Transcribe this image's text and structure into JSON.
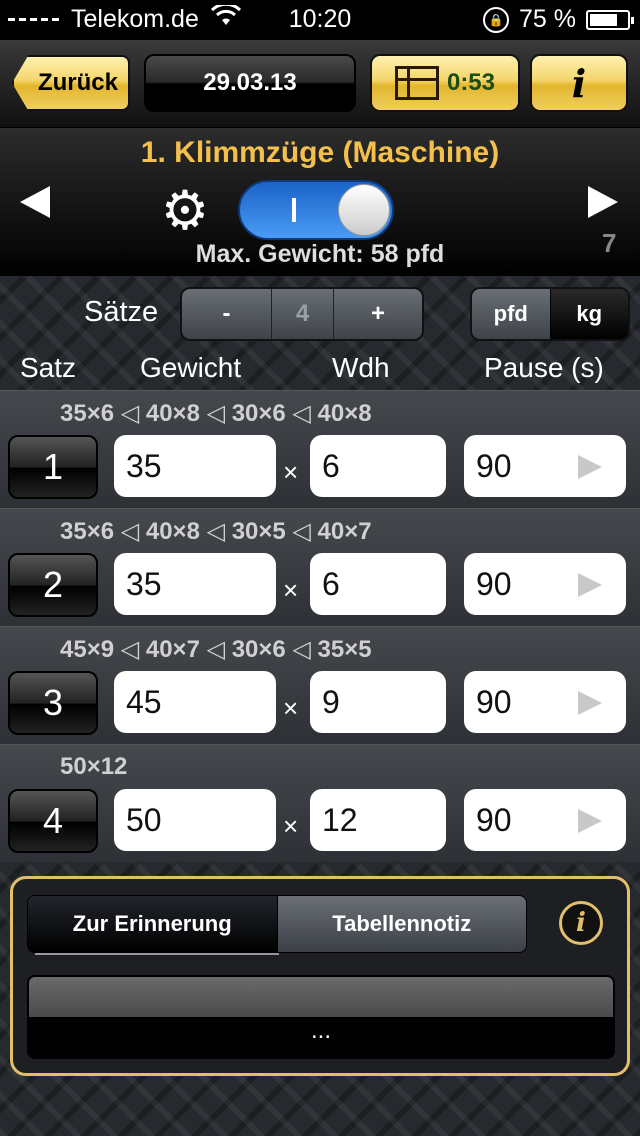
{
  "status": {
    "carrier": "Telekom.de",
    "time": "10:20",
    "battery": "75 %",
    "battery_level": 0.75
  },
  "nav": {
    "back_label": "Zurück",
    "date": "29.03.13",
    "timer": "0:53",
    "info_label": "i"
  },
  "exercise": {
    "title": "1. Klimmzüge (Maschine)",
    "max_weight": "Max. Gewicht: 58 pfd",
    "counter": "7",
    "toggle_on": true
  },
  "sets_control": {
    "label": "Sätze",
    "minus": "-",
    "value": "4",
    "plus": "+"
  },
  "units": {
    "pfd": "pfd",
    "kg": "kg",
    "selected": "kg"
  },
  "columns": {
    "set": "Satz",
    "weight": "Gewicht",
    "reps": "Wdh",
    "pause": "Pause (s)"
  },
  "sets": [
    {
      "num": "1",
      "history": "35×6 ◁ 40×8 ◁ 30×6 ◁ 40×8",
      "weight": "35",
      "reps": "6",
      "pause": "90"
    },
    {
      "num": "2",
      "history": "35×6 ◁ 40×8 ◁ 30×5 ◁ 40×7",
      "weight": "35",
      "reps": "6",
      "pause": "90"
    },
    {
      "num": "3",
      "history": "45×9 ◁ 40×7 ◁ 30×6 ◁ 35×5",
      "weight": "45",
      "reps": "9",
      "pause": "90"
    },
    {
      "num": "4",
      "history": "50×12",
      "weight": "50",
      "reps": "12",
      "pause": "90"
    }
  ],
  "times_symbol": "×",
  "notes": {
    "tab_reminder": "Zur Erinnerung",
    "tab_table_note": "Tabellennotiz",
    "info_label": "i",
    "content": "..."
  },
  "colors": {
    "accent_gold": "#f3c04e",
    "toggle_blue": "#2f80e8",
    "panel_border": "#e2bf6c"
  }
}
